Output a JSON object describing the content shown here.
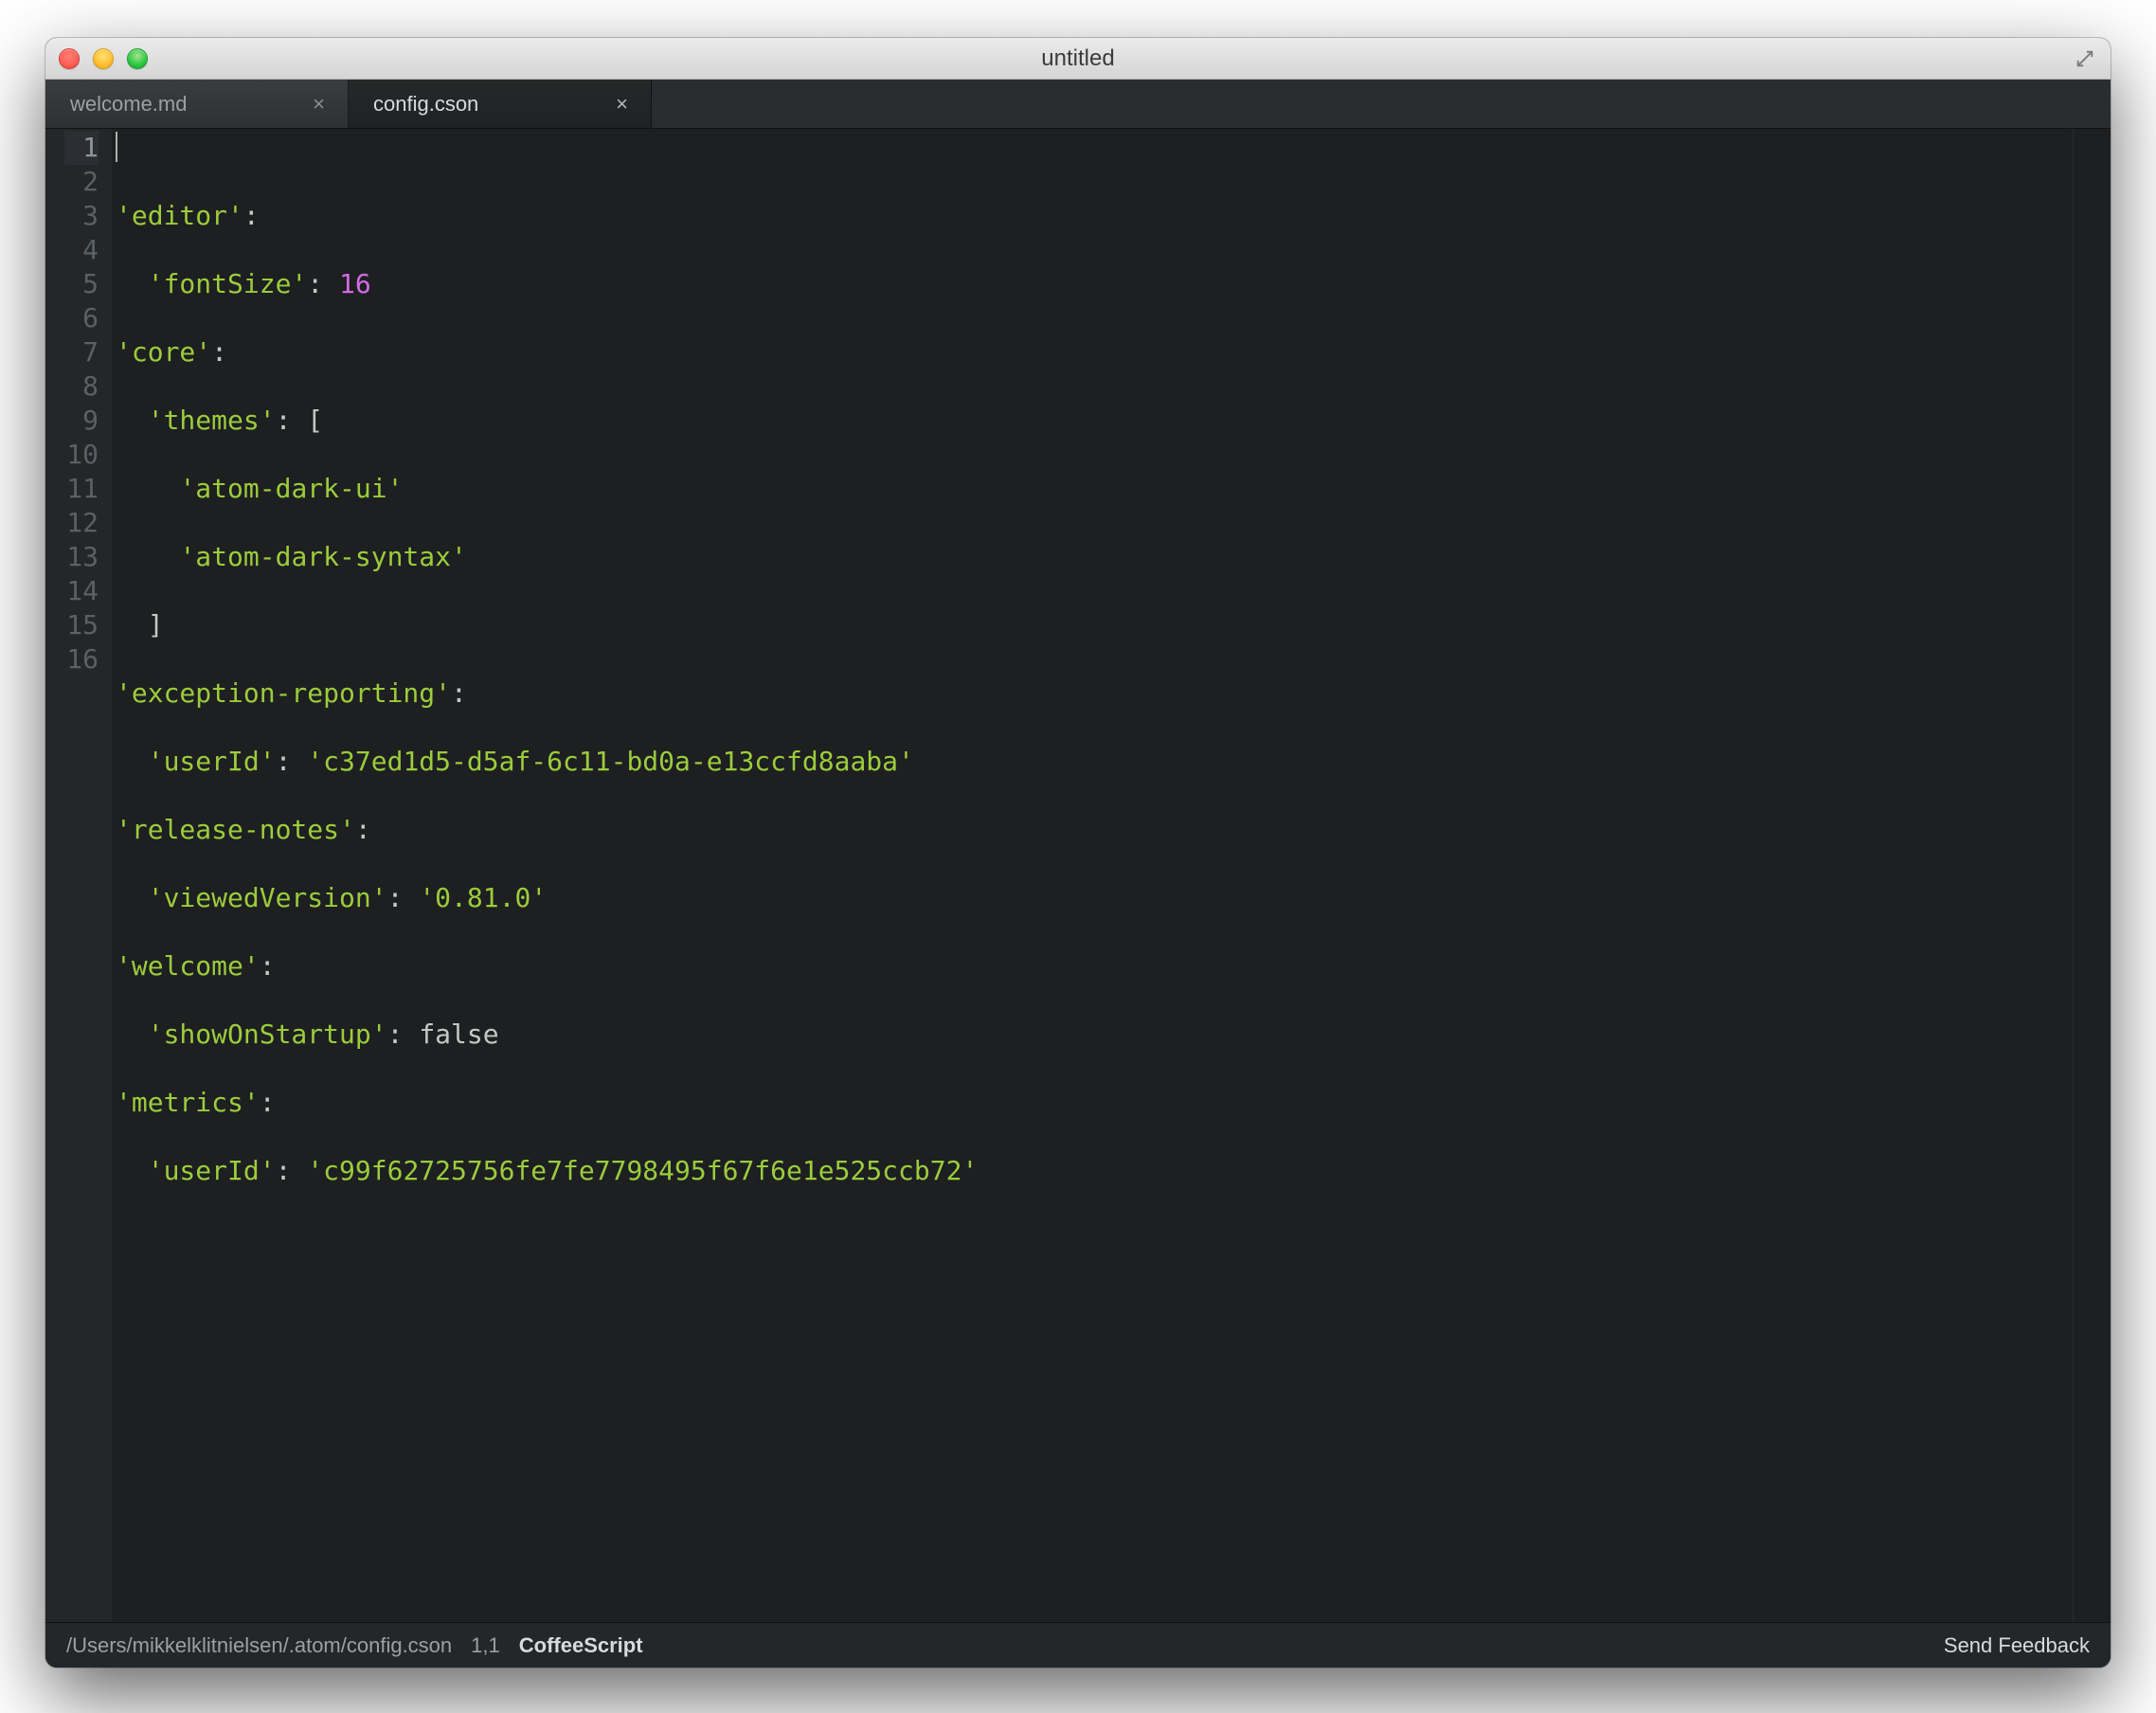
{
  "window": {
    "title": "untitled"
  },
  "tabs": [
    {
      "label": "welcome.md",
      "active": false
    },
    {
      "label": "config.cson",
      "active": true
    }
  ],
  "lineNumbers": [
    "1",
    "2",
    "3",
    "4",
    "5",
    "6",
    "7",
    "8",
    "9",
    "10",
    "11",
    "12",
    "13",
    "14",
    "15",
    "16"
  ],
  "code": {
    "l1": {
      "a": "'editor'",
      "b": ":"
    },
    "l2": {
      "a": "'fontSize'",
      "b": ": ",
      "c": "16"
    },
    "l3": {
      "a": "'core'",
      "b": ":"
    },
    "l4": {
      "a": "'themes'",
      "b": ": ["
    },
    "l5": {
      "a": "'atom-dark-ui'"
    },
    "l6": {
      "a": "'atom-dark-syntax'"
    },
    "l7": {
      "a": "]"
    },
    "l8": {
      "a": "'exception-reporting'",
      "b": ":"
    },
    "l9": {
      "a": "'userId'",
      "b": ": ",
      "c": "'c37ed1d5-d5af-6c11-bd0a-e13ccfd8aaba'"
    },
    "l10": {
      "a": "'release-notes'",
      "b": ":"
    },
    "l11": {
      "a": "'viewedVersion'",
      "b": ": ",
      "c": "'0.81.0'"
    },
    "l12": {
      "a": "'welcome'",
      "b": ":"
    },
    "l13": {
      "a": "'showOnStartup'",
      "b": ": ",
      "c": "false"
    },
    "l14": {
      "a": "'metrics'",
      "b": ":"
    },
    "l15": {
      "a": "'userId'",
      "b": ": ",
      "c": "'c99f62725756fe7fe7798495f67f6e1e525ccb72'"
    }
  },
  "status": {
    "path": "/Users/mikkelklitnielsen/.atom/config.cson",
    "cursor": "1,1",
    "language": "CoffeeScript",
    "feedback": "Send Feedback"
  }
}
